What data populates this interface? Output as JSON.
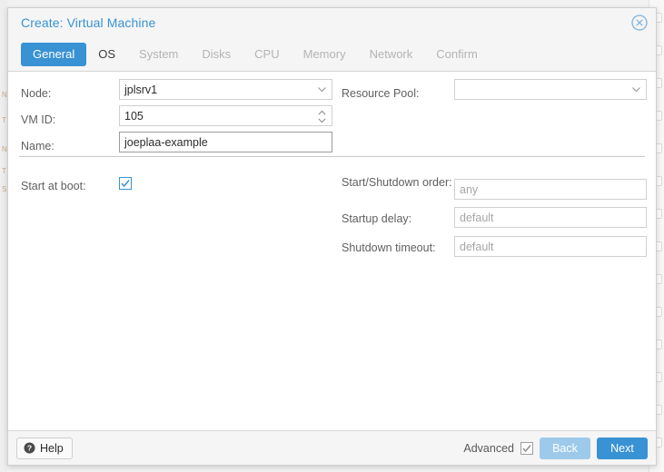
{
  "background": {
    "right_rail_rows": 14,
    "left_hints": [
      "N",
      "T",
      "N",
      "T",
      "S"
    ]
  },
  "dialog": {
    "title": "Create: Virtual Machine",
    "close_icon": "circle-x-icon",
    "tabs": [
      {
        "label": "General",
        "state": "active"
      },
      {
        "label": "OS",
        "state": "enabled"
      },
      {
        "label": "System",
        "state": "disabled"
      },
      {
        "label": "Disks",
        "state": "disabled"
      },
      {
        "label": "CPU",
        "state": "disabled"
      },
      {
        "label": "Memory",
        "state": "disabled"
      },
      {
        "label": "Network",
        "state": "disabled"
      },
      {
        "label": "Confirm",
        "state": "disabled"
      }
    ],
    "form": {
      "node": {
        "label": "Node:",
        "value": "jplsrv1",
        "icon": "chevron-down-icon"
      },
      "vmid": {
        "label": "VM ID:",
        "value": "105",
        "icon": "spinner-arrows-icon"
      },
      "name": {
        "label": "Name:",
        "value": "joeplaa-example"
      },
      "resource_pool": {
        "label": "Resource Pool:",
        "value": "",
        "icon": "chevron-down-icon"
      },
      "start_at_boot": {
        "label": "Start at boot:",
        "checked": true,
        "icon": "checkmark-icon"
      },
      "start_shutdown_order": {
        "label": "Start/Shutdown order:",
        "value": "",
        "placeholder": "any"
      },
      "startup_delay": {
        "label": "Startup delay:",
        "value": "",
        "placeholder": "default"
      },
      "shutdown_timeout": {
        "label": "Shutdown timeout:",
        "value": "",
        "placeholder": "default"
      }
    },
    "footer": {
      "help_label": "Help",
      "help_icon": "question-circle-icon",
      "advanced_label": "Advanced",
      "advanced_checked": true,
      "advanced_icon": "checkmark-icon",
      "back_label": "Back",
      "next_label": "Next"
    }
  },
  "colors": {
    "accent": "#3892d4",
    "accent_disabled": "#9dcaea",
    "header_bg": "#f5f5f5",
    "label_text": "#606060",
    "tab_disabled": "#b4b4b4",
    "placeholder": "#a6a6a6"
  }
}
